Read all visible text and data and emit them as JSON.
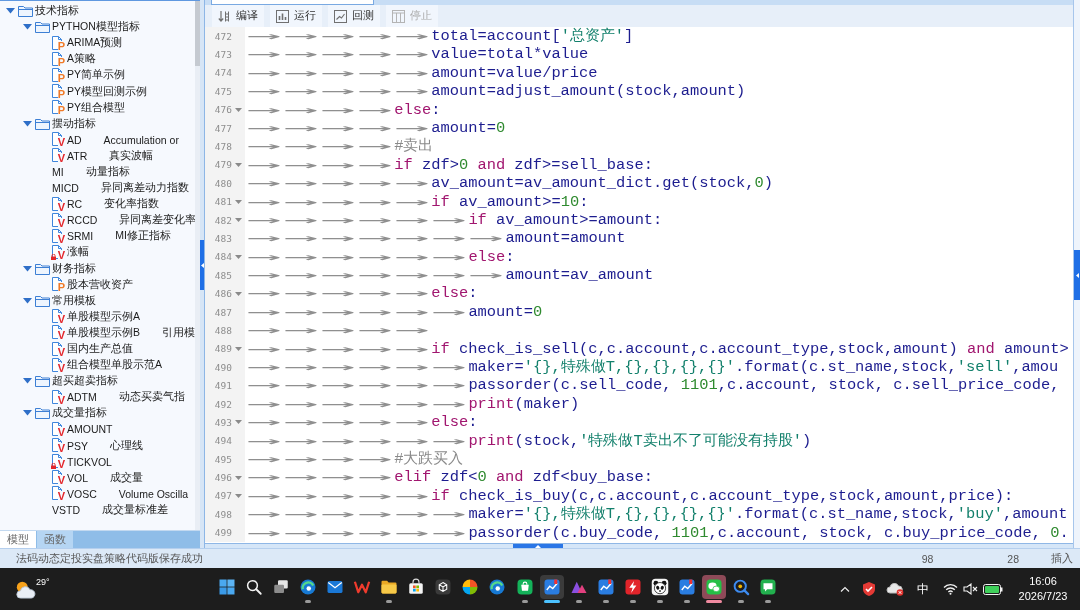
{
  "tree": {
    "items": [
      {
        "kind": "folder",
        "label": "技术指标",
        "expanded": true,
        "children": [
          {
            "kind": "folder",
            "label": "PYTHON模型指标",
            "expanded": true,
            "children": [
              {
                "kind": "python",
                "badge": "P",
                "locked": false,
                "name": "ARIMA预测"
              },
              {
                "kind": "python",
                "badge": "P",
                "locked": false,
                "name": "A策略"
              },
              {
                "kind": "python",
                "badge": "P",
                "locked": false,
                "name": "PY简单示例"
              },
              {
                "kind": "python",
                "badge": "P",
                "locked": false,
                "name": "PY模型回测示例"
              },
              {
                "kind": "python",
                "badge": "P",
                "locked": false,
                "name": "PY组合模型"
              }
            ]
          },
          {
            "kind": "folder",
            "label": "摆动指标",
            "expanded": true,
            "children": [
              {
                "kind": "formula",
                "badge": "V",
                "locked": false,
                "name": "AD",
                "description": "Accumulation or"
              },
              {
                "kind": "formula",
                "badge": "V",
                "locked": false,
                "name": "ATR",
                "description": "真实波幅"
              },
              {
                "kind": "plain",
                "name": "MI",
                "description": "动量指标"
              },
              {
                "kind": "plain",
                "name": "MICD",
                "description": "异同离差动力指数"
              },
              {
                "kind": "formula",
                "badge": "V",
                "locked": false,
                "name": "RC",
                "description": "变化率指数"
              },
              {
                "kind": "formula",
                "badge": "V",
                "locked": false,
                "name": "RCCD",
                "description": "异同离差变化率"
              },
              {
                "kind": "formula",
                "badge": "V",
                "locked": false,
                "name": "SRMI",
                "description": "MI修正指标"
              },
              {
                "kind": "formula",
                "badge": "V",
                "locked": true,
                "name": "涨幅"
              }
            ]
          },
          {
            "kind": "folder",
            "label": "财务指标",
            "expanded": true,
            "children": [
              {
                "kind": "python",
                "badge": "P",
                "locked": false,
                "name": "股本营收资产"
              }
            ]
          },
          {
            "kind": "folder",
            "label": "常用模板",
            "expanded": true,
            "children": [
              {
                "kind": "formula",
                "badge": "V",
                "locked": false,
                "name": "单股模型示例A"
              },
              {
                "kind": "formula",
                "badge": "V",
                "locked": false,
                "name": "单股模型示例B",
                "description": "引用模"
              },
              {
                "kind": "formula",
                "badge": "V",
                "locked": false,
                "name": "国内生产总值"
              },
              {
                "kind": "formula",
                "badge": "V",
                "locked": false,
                "name": "组合模型单股示范A"
              }
            ]
          },
          {
            "kind": "folder",
            "label": "超买超卖指标",
            "expanded": true,
            "children": [
              {
                "kind": "formula",
                "badge": "V",
                "locked": false,
                "name": "ADTM",
                "description": "动态买卖气指"
              }
            ]
          },
          {
            "kind": "folder",
            "label": "成交量指标",
            "expanded": true,
            "children": [
              {
                "kind": "formula",
                "badge": "V",
                "locked": false,
                "name": "AMOUNT"
              },
              {
                "kind": "formula",
                "badge": "V",
                "locked": false,
                "name": "PSY",
                "description": "心理线"
              },
              {
                "kind": "formula",
                "badge": "V",
                "locked": true,
                "name": "TICKVOL"
              },
              {
                "kind": "formula",
                "badge": "V",
                "locked": false,
                "name": "VOL",
                "description": "成交量"
              },
              {
                "kind": "formula",
                "badge": "V",
                "locked": false,
                "name": "VOSC",
                "description": "Volume Oscilla"
              },
              {
                "kind": "plain",
                "name": "VSTD",
                "description": "成交量标准差"
              }
            ]
          }
        ]
      }
    ]
  },
  "left_tabs": [
    {
      "label": "模型",
      "selected": true
    },
    {
      "label": "函数",
      "selected": false
    }
  ],
  "toolbar": {
    "buttons": [
      {
        "kind": "compile",
        "label": "编译",
        "disabled": false
      },
      {
        "kind": "run",
        "label": "运行",
        "disabled": false
      },
      {
        "kind": "backtest",
        "label": "回测",
        "disabled": false
      },
      {
        "kind": "stop",
        "label": "停止",
        "disabled": true
      }
    ]
  },
  "editor": {
    "lines": [
      {
        "number": "472",
        "foldable": false,
        "tab_markers": "→→→→→",
        "tokens": [
          {
            "kind": "plain",
            "text": "total=account["
          },
          {
            "kind": "string",
            "text": "'总资产'"
          },
          {
            "kind": "plain",
            "text": "]"
          }
        ]
      },
      {
        "number": "473",
        "foldable": false,
        "tab_markers": "→→→→→",
        "tokens": [
          {
            "kind": "plain",
            "text": "value=total*value"
          }
        ]
      },
      {
        "number": "474",
        "foldable": false,
        "tab_markers": "→→→→→",
        "tokens": [
          {
            "kind": "plain",
            "text": "amount=value/price"
          }
        ]
      },
      {
        "number": "475",
        "foldable": false,
        "tab_markers": "→→→→→",
        "tokens": [
          {
            "kind": "plain",
            "text": "amount=adjust_amount(stock,amount)"
          }
        ]
      },
      {
        "number": "476",
        "foldable": true,
        "tab_markers": "→→→→",
        "tokens": [
          {
            "kind": "keyword",
            "text": "else"
          },
          {
            "kind": "plain",
            "text": ":"
          }
        ]
      },
      {
        "number": "477",
        "foldable": false,
        "tab_markers": "→→→→→",
        "tokens": [
          {
            "kind": "plain",
            "text": "amount="
          },
          {
            "kind": "number",
            "text": "0"
          }
        ]
      },
      {
        "number": "478",
        "foldable": false,
        "tab_markers": "→→→→",
        "tokens": [
          {
            "kind": "comment",
            "text": "#卖出"
          }
        ]
      },
      {
        "number": "479",
        "foldable": true,
        "tab_markers": "→→→→",
        "tokens": [
          {
            "kind": "keyword",
            "text": "if"
          },
          {
            "kind": "plain",
            "text": " zdf>"
          },
          {
            "kind": "number",
            "text": "0"
          },
          {
            "kind": "keyword",
            "text": " and"
          },
          {
            "kind": "plain",
            "text": " zdf>=sell_base:"
          }
        ]
      },
      {
        "number": "480",
        "foldable": false,
        "tab_markers": "→→→→→",
        "tokens": [
          {
            "kind": "plain",
            "text": "av_amount=av_amount_dict.get(stock,"
          },
          {
            "kind": "number",
            "text": "0"
          },
          {
            "kind": "plain",
            "text": ")"
          }
        ]
      },
      {
        "number": "481",
        "foldable": true,
        "tab_markers": "→→→→→",
        "tokens": [
          {
            "kind": "keyword",
            "text": "if"
          },
          {
            "kind": "plain",
            "text": " av_amount>="
          },
          {
            "kind": "number",
            "text": "10"
          },
          {
            "kind": "plain",
            "text": ":"
          }
        ]
      },
      {
        "number": "482",
        "foldable": true,
        "tab_markers": "→→→→→→",
        "tokens": [
          {
            "kind": "keyword",
            "text": "if"
          },
          {
            "kind": "plain",
            "text": " av_amount>=amount:"
          }
        ]
      },
      {
        "number": "483",
        "foldable": false,
        "tab_markers": "→→→→→→→",
        "tokens": [
          {
            "kind": "plain",
            "text": "amount=amount"
          }
        ]
      },
      {
        "number": "484",
        "foldable": true,
        "tab_markers": "→→→→→→",
        "tokens": [
          {
            "kind": "keyword",
            "text": "else"
          },
          {
            "kind": "plain",
            "text": ":"
          }
        ]
      },
      {
        "number": "485",
        "foldable": false,
        "tab_markers": "→→→→→→→",
        "tokens": [
          {
            "kind": "plain",
            "text": "amount=av_amount"
          }
        ]
      },
      {
        "number": "486",
        "foldable": true,
        "tab_markers": "→→→→→",
        "tokens": [
          {
            "kind": "keyword",
            "text": "else"
          },
          {
            "kind": "plain",
            "text": ":"
          }
        ]
      },
      {
        "number": "487",
        "foldable": false,
        "tab_markers": "→→→→→→",
        "tokens": [
          {
            "kind": "plain",
            "text": "amount="
          },
          {
            "kind": "number",
            "text": "0"
          }
        ]
      },
      {
        "number": "488",
        "foldable": false,
        "tab_markers": "→→→→→"
      },
      {
        "number": "489",
        "foldable": true,
        "tab_markers": "→→→→→",
        "tokens": [
          {
            "kind": "keyword",
            "text": "if"
          },
          {
            "kind": "plain",
            "text": " check_is_sell(c,c.account,c.account_type,stock,amount)"
          },
          {
            "kind": "keyword",
            "text": " and"
          },
          {
            "kind": "plain",
            "text": " amount>"
          }
        ]
      },
      {
        "number": "490",
        "foldable": false,
        "tab_markers": "→→→→→→",
        "tokens": [
          {
            "kind": "plain",
            "text": "maker="
          },
          {
            "kind": "string",
            "text": "'{},特殊做T,{},{},{},{}'"
          },
          {
            "kind": "plain",
            "text": ".format(c.st_name,stock,"
          },
          {
            "kind": "string",
            "text": "'sell'"
          },
          {
            "kind": "plain",
            "text": ",amou"
          }
        ]
      },
      {
        "number": "491",
        "foldable": false,
        "tab_markers": "→→→→→→",
        "tokens": [
          {
            "kind": "plain",
            "text": "passorder(c.sell_code, "
          },
          {
            "kind": "number",
            "text": "1101"
          },
          {
            "kind": "plain",
            "text": ",c.account, stock, c.sell_price_code,"
          }
        ]
      },
      {
        "number": "492",
        "foldable": false,
        "tab_markers": "→→→→→→",
        "tokens": [
          {
            "kind": "keyword",
            "text": "print"
          },
          {
            "kind": "plain",
            "text": "(maker)"
          }
        ]
      },
      {
        "number": "493",
        "foldable": true,
        "tab_markers": "→→→→→",
        "tokens": [
          {
            "kind": "keyword",
            "text": "else"
          },
          {
            "kind": "plain",
            "text": ":"
          }
        ]
      },
      {
        "number": "494",
        "foldable": false,
        "tab_markers": "→→→→→→",
        "tokens": [
          {
            "kind": "keyword",
            "text": "print"
          },
          {
            "kind": "plain",
            "text": "(stock,"
          },
          {
            "kind": "string",
            "text": "'特殊做T卖出不了可能没有持股'"
          },
          {
            "kind": "plain",
            "text": ")"
          }
        ]
      },
      {
        "number": "495",
        "foldable": false,
        "tab_markers": "→→→→",
        "tokens": [
          {
            "kind": "comment",
            "text": "#大跌买入"
          }
        ]
      },
      {
        "number": "496",
        "foldable": true,
        "tab_markers": "→→→→",
        "tokens": [
          {
            "kind": "keyword",
            "text": "elif"
          },
          {
            "kind": "plain",
            "text": " zdf<"
          },
          {
            "kind": "number",
            "text": "0"
          },
          {
            "kind": "keyword",
            "text": " and"
          },
          {
            "kind": "plain",
            "text": " zdf<buy_base:"
          }
        ]
      },
      {
        "number": "497",
        "foldable": true,
        "tab_markers": "→→→→→",
        "tokens": [
          {
            "kind": "keyword",
            "text": "if"
          },
          {
            "kind": "plain",
            "text": " check_is_buy(c,c.account,c.account_type,stock,amount,price):"
          }
        ]
      },
      {
        "number": "498",
        "foldable": false,
        "tab_markers": "→→→→→→",
        "tokens": [
          {
            "kind": "plain",
            "text": "maker="
          },
          {
            "kind": "string",
            "text": "'{},特殊做T,{},{},{},{}'"
          },
          {
            "kind": "plain",
            "text": ".format(c.st_name,stock,"
          },
          {
            "kind": "string",
            "text": "'buy'"
          },
          {
            "kind": "plain",
            "text": ",amount"
          }
        ]
      },
      {
        "number": "499",
        "foldable": false,
        "tab_markers": "→→→→→→",
        "tokens": [
          {
            "kind": "plain",
            "text": "passorder(c.buy_code, "
          },
          {
            "kind": "number",
            "text": "1101"
          },
          {
            "kind": "plain",
            "text": ",c.account, stock, c.buy_price_code, "
          },
          {
            "kind": "number",
            "text": "0"
          },
          {
            "kind": "plain",
            "text": "."
          }
        ]
      }
    ]
  },
  "status_bar": {
    "message": "法码动态定投实盘策略代码版保存成功",
    "fields": [
      "98",
      "28",
      "插入"
    ]
  },
  "taskbar": {
    "weather": {
      "temperature": "29°"
    },
    "apps": [
      {
        "kind": "windows",
        "running": false,
        "focused": false,
        "highlighted": false
      },
      {
        "kind": "search",
        "running": false,
        "focused": false,
        "highlighted": false
      },
      {
        "kind": "task-view",
        "running": false,
        "focused": false,
        "highlighted": false
      },
      {
        "kind": "swirl",
        "running": true,
        "focused": false,
        "highlighted": false
      },
      {
        "kind": "mail",
        "running": false,
        "focused": false,
        "highlighted": false
      },
      {
        "kind": "zigzag",
        "running": false,
        "focused": false,
        "highlighted": false
      },
      {
        "kind": "folder",
        "running": true,
        "focused": false,
        "highlighted": false
      },
      {
        "kind": "store",
        "running": false,
        "focused": false,
        "highlighted": false
      },
      {
        "kind": "cube",
        "running": false,
        "focused": false,
        "highlighted": false
      },
      {
        "kind": "color-wheel",
        "running": false,
        "focused": false,
        "highlighted": false
      },
      {
        "kind": "swirl",
        "running": false,
        "focused": false,
        "highlighted": false
      },
      {
        "kind": "bag",
        "running": true,
        "focused": false,
        "highlighted": false
      },
      {
        "kind": "chart",
        "running": true,
        "focused": true,
        "highlighted": false
      },
      {
        "kind": "mountain",
        "running": true,
        "focused": false,
        "highlighted": false
      },
      {
        "kind": "chart",
        "running": true,
        "focused": false,
        "highlighted": false
      },
      {
        "kind": "lightning",
        "running": true,
        "focused": false,
        "highlighted": false
      },
      {
        "kind": "panda",
        "running": true,
        "focused": false,
        "highlighted": false
      },
      {
        "kind": "chart",
        "running": true,
        "focused": false,
        "highlighted": false
      },
      {
        "kind": "chat",
        "running": true,
        "focused": false,
        "highlighted": true
      },
      {
        "kind": "magnifier",
        "running": true,
        "focused": false,
        "highlighted": false
      },
      {
        "kind": "message",
        "running": true,
        "focused": false,
        "highlighted": false
      }
    ],
    "tray": {
      "input_method": "中",
      "volume_muted": true,
      "time": "16:06",
      "date": "2026/7/23"
    }
  }
}
